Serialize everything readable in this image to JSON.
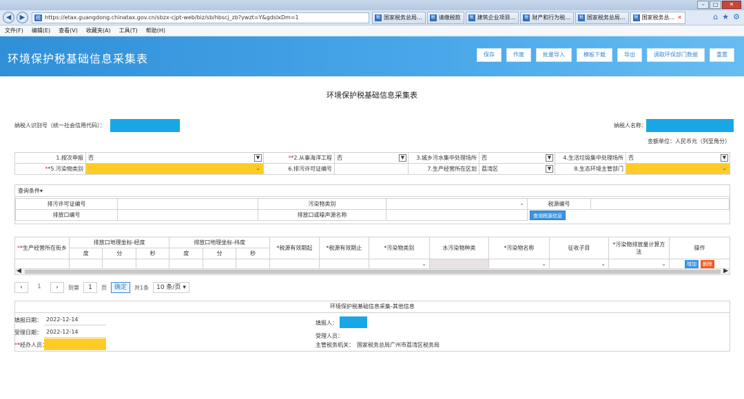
{
  "browser": {
    "url": "https://etax.guangdong.chinatax.gov.cn/sbzx-cjpt-web/biz/sb/hbscj_zb?ywzt=Y&gdslxDm=1",
    "tabs": [
      {
        "label": "国家税务总局..."
      },
      {
        "label": "请缴税款"
      },
      {
        "label": "建筑企业项目..."
      },
      {
        "label": "财产和行为税..."
      },
      {
        "label": "国家税务总局..."
      },
      {
        "label": "国家税务总..."
      }
    ],
    "menu": [
      "文件(F)",
      "编辑(E)",
      "查看(V)",
      "收藏夹(A)",
      "工具(T)",
      "帮助(H)"
    ]
  },
  "header": {
    "title": "环境保护税基础信息采集表",
    "buttons": [
      "保存",
      "作废",
      "批量导入",
      "模板下载",
      "导出",
      "调取环保部门数据",
      "重置"
    ]
  },
  "form": {
    "title": "环境保护税基础信息采集表",
    "taxpayer_id_label": "纳税人识别号（统一社会信用代码）：",
    "taxpayer_name_label": "纳税人名称：",
    "unit": "金额单位：人民币元（列至角分）",
    "row1": {
      "l1": "1.按次申报",
      "v1": "否",
      "l2": "*2.从事海洋工程",
      "v2": "否",
      "l3": "3.城乡污水集中处理场所",
      "v3": "否",
      "l4": "4.生活垃圾集中处理场所",
      "v4": "否"
    },
    "row2": {
      "l5": "*5.污染物类别",
      "l6": "6.排污许可证编号",
      "l7": "7.生产经营所在区划",
      "v7": "荔湾区",
      "l8": "8.生态环境主管部门"
    }
  },
  "query": {
    "toggle": "查询条件",
    "permit_label": "排污许可证编号",
    "pollutant_type_label": "污染物类别",
    "tax_source_label": "税源编号",
    "outlet_label": "排放口编号",
    "outlet_name_label": "排放口或噪声源名称",
    "query_button": "查询税源信息"
  },
  "grid": {
    "street": "*生产经营所在街乡",
    "lon_group": "排放口地理坐标-经度",
    "lat_group": "排放口地理坐标-纬度",
    "deg": "度",
    "min": "分",
    "sec": "秒",
    "start": "*税源有效期起",
    "end": "*税源有效期止",
    "ptype": "*污染物类别",
    "water": "水污染物种类",
    "pname": "*污染物名称",
    "subitem": "征收子目",
    "method": "*污染物排放量计算方法",
    "ops": "操作",
    "add": "增加",
    "del": "删除"
  },
  "pager": {
    "current": "1",
    "goto_label": "到第",
    "goto_value": "1",
    "page_label": "页",
    "confirm": "确定",
    "total": "共1条",
    "size": "10 条/页"
  },
  "other": {
    "title": "环境保护税基础信息采集-其他信息",
    "fill_date_label": "填报日期：",
    "fill_date": "2022-12-14",
    "accept_date_label": "受理日期：",
    "accept_date": "2022-12-14",
    "handler_label": "*经办人员：",
    "filler_label": "填报人：",
    "acceptor_label": "受理人员：",
    "authority_label": "主管税务机关：",
    "authority": "国家税务总局广州市荔湾区税务局"
  }
}
